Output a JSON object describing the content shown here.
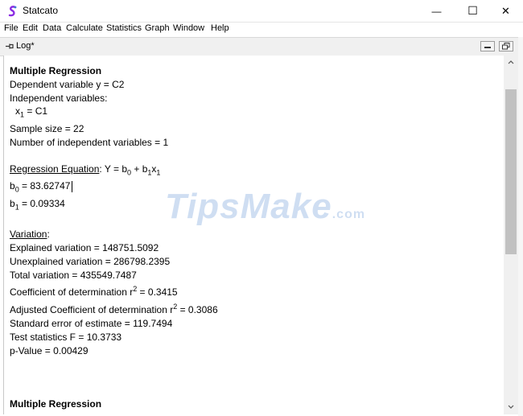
{
  "window": {
    "title": "Statcato",
    "minimize_glyph": "—",
    "maximize_glyph": "☐",
    "close_glyph": "✕"
  },
  "menu": {
    "items": [
      "File",
      "Edit",
      "Data",
      "Calculate",
      "Statistics",
      "Graph",
      "Window",
      "Help"
    ]
  },
  "log_window": {
    "title": "Log*",
    "icon": "pin-icon"
  },
  "log": {
    "heading": "Multiple Regression",
    "dependent": "Dependent variable y = C2",
    "independent_label": "Independent variables:",
    "x1_var": "x",
    "x1_sub": "1",
    "x1_val": " = C1",
    "sample_size": "Sample size = 22",
    "num_independent": "Number of independent variables = 1",
    "reg_eq_label": "Regression Equation",
    "reg_eq_text": ": Y = b",
    "reg_eq_sub0": "0",
    "reg_eq_plus": " + b",
    "reg_eq_sub1": "1",
    "reg_eq_x": "x",
    "reg_eq_subx": "1",
    "b0_var": "b",
    "b0_sub": "0",
    "b0_val": " = 83.62747",
    "b1_var": "b",
    "b1_sub": "1",
    "b1_val": " = 0.09334",
    "variation_label": "Variation",
    "variation_colon": ":",
    "explained": "Explained variation = 148751.5092",
    "unexplained": "Unexplained variation = 286798.2395",
    "total": "Total variation = 435549.7487",
    "coef_det_text": "Coefficient of determination r",
    "coef_det_sup": "2",
    "coef_det_val": " = 0.3415",
    "adj_coef_text": "Adjusted Coefficient of determination r",
    "adj_coef_sup": "2",
    "adj_coef_val": " = 0.3086",
    "std_err": "Standard error of estimate = 119.7494",
    "test_stat": "Test statistics F = 10.3733",
    "p_value": "p-Value = 0.00429",
    "heading2": "Multiple Regression"
  },
  "watermark": {
    "text": "TipsMake",
    "suffix": ".com"
  }
}
